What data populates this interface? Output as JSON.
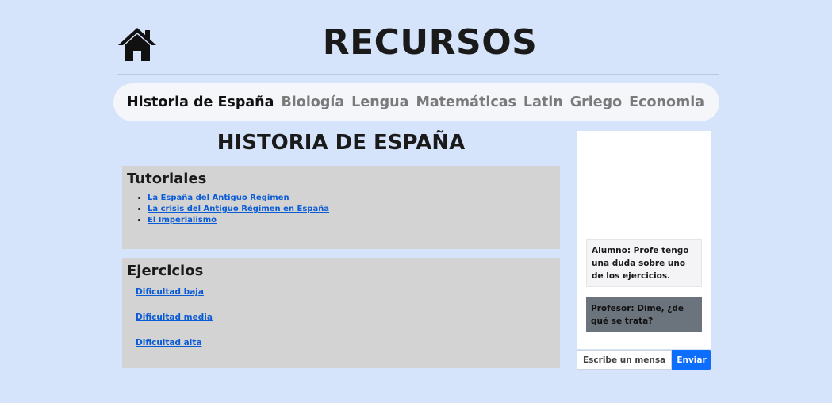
{
  "header": {
    "title": "RECURSOS",
    "home_icon": "house-icon"
  },
  "nav": {
    "items": [
      {
        "label": "Historia de España",
        "active": true
      },
      {
        "label": "Biología"
      },
      {
        "label": "Lengua"
      },
      {
        "label": "Matemáticas"
      },
      {
        "label": "Latin"
      },
      {
        "label": "Griego"
      },
      {
        "label": "Economia"
      }
    ]
  },
  "main": {
    "title": "HISTORIA DE ESPAÑA",
    "tutoriales": {
      "heading": "Tutoriales",
      "links": [
        "La España del Antiguo Régimen",
        "La crisis del Antiguo Régimen en España",
        "El Imperialismo"
      ]
    },
    "ejercicios": {
      "heading": "Ejercicios",
      "links": [
        "Dificultad baja",
        "Dificultad media",
        "Dificultad alta"
      ]
    }
  },
  "chat": {
    "messages": [
      {
        "role": "alumno",
        "text": "Alumno: Profe tengo una duda sobre uno de los ejercicios."
      },
      {
        "role": "profesor",
        "text": "Profesor: Dime, ¿de qué se trata?"
      }
    ],
    "input_placeholder": "Escribe un mensaje...",
    "send_label": "Enviar"
  },
  "colors": {
    "background": "#d6e4fb",
    "link": "#0a5bd6",
    "send_button": "#0d6efd",
    "card": "#d3d3d3"
  }
}
